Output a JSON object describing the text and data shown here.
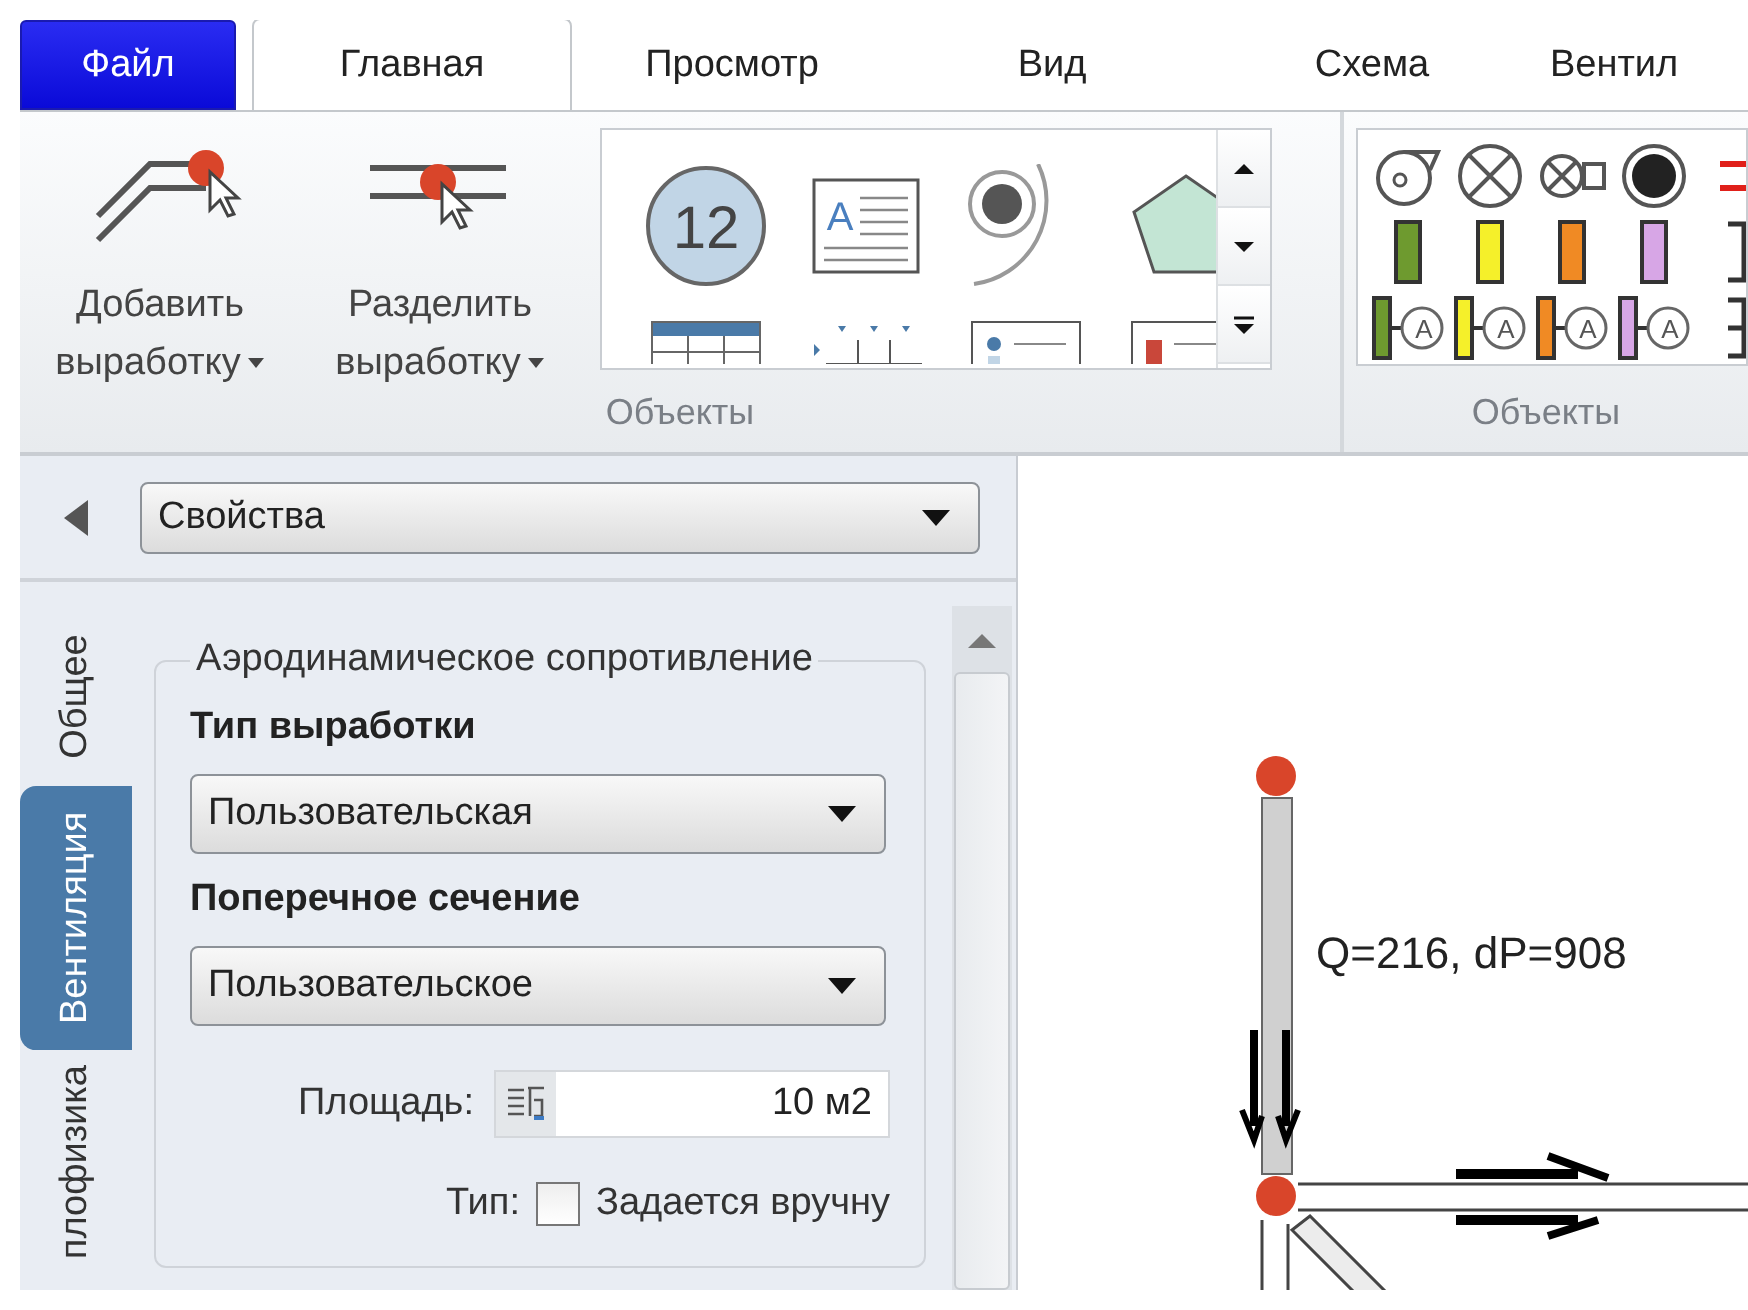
{
  "menu_tabs": [
    {
      "label": "Файл",
      "kind": "file",
      "selected": false
    },
    {
      "label": "Главная",
      "kind": "tab",
      "selected": true
    },
    {
      "label": "Просмотр",
      "kind": "tab",
      "selected": false
    },
    {
      "label": "Вид",
      "kind": "tab",
      "selected": false
    },
    {
      "label": "Схема",
      "kind": "tab",
      "selected": false
    },
    {
      "label": "Вентил",
      "kind": "tab",
      "selected": false
    }
  ],
  "ribbon": {
    "buttons": [
      {
        "label": "Добавить выработку",
        "kind": "add"
      },
      {
        "label": "Разделить выработку",
        "kind": "split"
      }
    ],
    "gallery": [
      {
        "kind": "counter",
        "text": "12"
      },
      {
        "kind": "note",
        "text": "A"
      },
      {
        "kind": "target"
      },
      {
        "kind": "pentagon"
      },
      {
        "kind": "table"
      },
      {
        "kind": "ticks"
      },
      {
        "kind": "legend"
      },
      {
        "kind": "card"
      }
    ],
    "symbols": [
      {
        "kind": "fan"
      },
      {
        "kind": "valve"
      },
      {
        "kind": "valve-small"
      },
      {
        "kind": "dark-circle"
      },
      {
        "kind": "red-lines"
      },
      {
        "kind": "bar",
        "color": "#6e9a2f"
      },
      {
        "kind": "bar",
        "color": "#f5f02a"
      },
      {
        "kind": "bar",
        "color": "#f08a24"
      },
      {
        "kind": "bar",
        "color": "#d7a6e6"
      },
      {
        "kind": "bracket"
      },
      {
        "kind": "sensor",
        "color": "#6e9a2f",
        "text": "A"
      },
      {
        "kind": "sensor",
        "color": "#f5f02a",
        "text": "A"
      },
      {
        "kind": "sensor",
        "color": "#f08a24",
        "text": "A"
      },
      {
        "kind": "sensor",
        "color": "#d7a6e6",
        "text": "A"
      },
      {
        "kind": "bracket-cross"
      }
    ],
    "groups": [
      "Объекты",
      "Объекты"
    ]
  },
  "panel": {
    "selector": "Свойства",
    "side_tabs": [
      {
        "label": "Общее",
        "selected": false
      },
      {
        "label": "Вентиляция",
        "selected": true
      },
      {
        "label": "плофизика",
        "selected": false
      }
    ],
    "group_title": "Аэродинамическое сопротивление",
    "fields": [
      {
        "kind": "dropdown",
        "label": "Тип выработки",
        "value": "Пользовательская"
      },
      {
        "kind": "dropdown",
        "label": "Поперечное сечение",
        "value": "Пользовательское"
      },
      {
        "kind": "input",
        "label": "Площадь:",
        "value": "10 м2"
      },
      {
        "kind": "checkbox",
        "label": "Тип:",
        "text": "Задается вручну",
        "checked": false
      }
    ]
  },
  "diagram": {
    "label": "Q=216, dP=908"
  }
}
